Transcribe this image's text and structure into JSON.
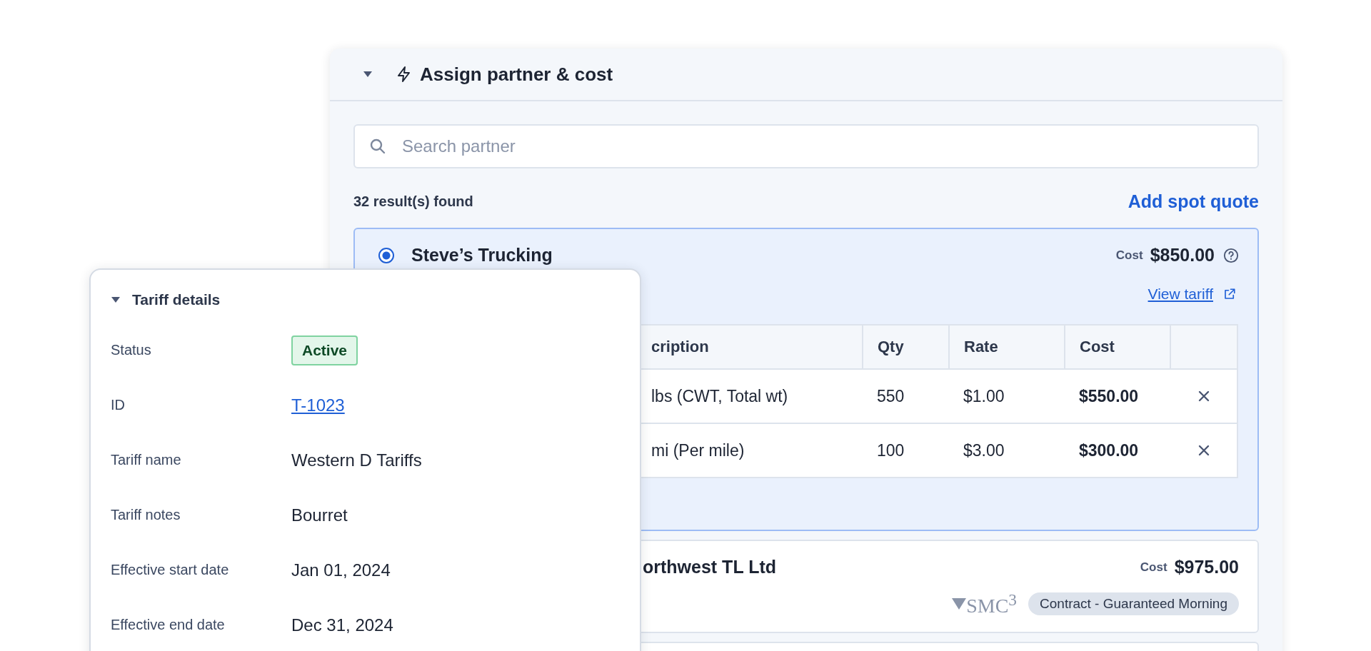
{
  "panel": {
    "title": "Assign partner & cost",
    "expanded": true
  },
  "search": {
    "placeholder": "Search partner"
  },
  "results_count": "32 result(s) found",
  "add_spot_quote": "Add spot quote",
  "partners": [
    {
      "name": "Steve’s Trucking",
      "selected": true,
      "cost_label": "Cost",
      "cost": "$850.00",
      "view_tariff": "View tariff",
      "table": {
        "columns": [
          "cription",
          "Qty",
          "Rate",
          "Cost"
        ],
        "rows": [
          [
            "lbs (CWT, Total wt)",
            "550",
            "$1.00",
            "$550.00"
          ],
          [
            "mi (Per mile)",
            "100",
            "$3.00",
            "$300.00"
          ]
        ]
      }
    },
    {
      "name": "orthwest TL Ltd",
      "selected": false,
      "cost_label": "Cost",
      "cost": "$975.00",
      "logo": "SMC$^{3}$",
      "tag": "Contract - Guaranteed Morning"
    }
  ],
  "tariff_details": {
    "title": "Tariff details",
    "expanded": true,
    "fields": [
      {
        "label": "Status",
        "value": "Active",
        "kind": "badge"
      },
      {
        "label": "ID",
        "value": "T-1023",
        "kind": "link"
      },
      {
        "label": "Tariff name",
        "value": "Western D Tariffs",
        "kind": "text"
      },
      {
        "label": "Tariff notes",
        "value": "Bourret",
        "kind": "text"
      },
      {
        "label": "Effective start date",
        "value": "Jan 01, 2024",
        "kind": "text"
      },
      {
        "label": "Effective end date",
        "value": "Dec 31, 2024",
        "kind": "text"
      }
    ]
  }
}
